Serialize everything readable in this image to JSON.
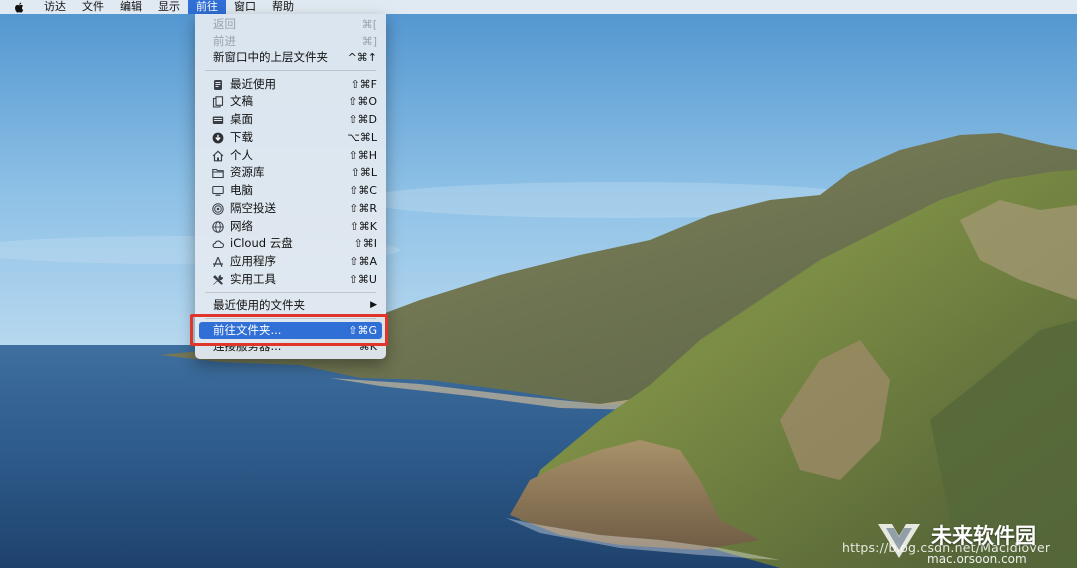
{
  "menubar": {
    "apple_icon": "apple-logo-icon",
    "items": [
      "访达",
      "文件",
      "编辑",
      "显示",
      "前往",
      "窗口",
      "帮助"
    ],
    "active_index": 4
  },
  "go_menu": {
    "back": {
      "label": "返回",
      "shortcut": "⌘["
    },
    "forward": {
      "label": "前进",
      "shortcut": "⌘]"
    },
    "enclosing": {
      "label": "新窗口中的上层文件夹",
      "shortcut": "^⌘↑"
    },
    "places": [
      {
        "label": "最近使用",
        "shortcut": "⇧⌘F",
        "icon": "recents-icon"
      },
      {
        "label": "文稿",
        "shortcut": "⇧⌘O",
        "icon": "documents-icon"
      },
      {
        "label": "桌面",
        "shortcut": "⇧⌘D",
        "icon": "desktop-icon"
      },
      {
        "label": "下载",
        "shortcut": "⌥⌘L",
        "icon": "downloads-icon"
      },
      {
        "label": "个人",
        "shortcut": "⇧⌘H",
        "icon": "home-icon"
      },
      {
        "label": "资源库",
        "shortcut": "⇧⌘L",
        "icon": "library-folder-icon"
      },
      {
        "label": "电脑",
        "shortcut": "⇧⌘C",
        "icon": "computer-icon"
      },
      {
        "label": "隔空投送",
        "shortcut": "⇧⌘R",
        "icon": "airdrop-icon"
      },
      {
        "label": "网络",
        "shortcut": "⇧⌘K",
        "icon": "network-globe-icon"
      },
      {
        "label": "iCloud 云盘",
        "shortcut": "⇧⌘I",
        "icon": "icloud-icon"
      },
      {
        "label": "应用程序",
        "shortcut": "⇧⌘A",
        "icon": "applications-icon"
      },
      {
        "label": "实用工具",
        "shortcut": "⇧⌘U",
        "icon": "utilities-icon"
      }
    ],
    "recent_folders": {
      "label": "最近使用的文件夹",
      "shortcut": "▶"
    },
    "go_to_folder": {
      "label": "前往文件夹...",
      "shortcut": "⇧⌘G"
    },
    "connect_server": {
      "label": "连接服务器...",
      "shortcut": "⌘K"
    }
  },
  "highlight_color": "#e0352b",
  "watermark": {
    "url": "https://blog.csdn.net/Macldlover",
    "brand": "未来软件园",
    "site": "mac.orsoon.com"
  }
}
